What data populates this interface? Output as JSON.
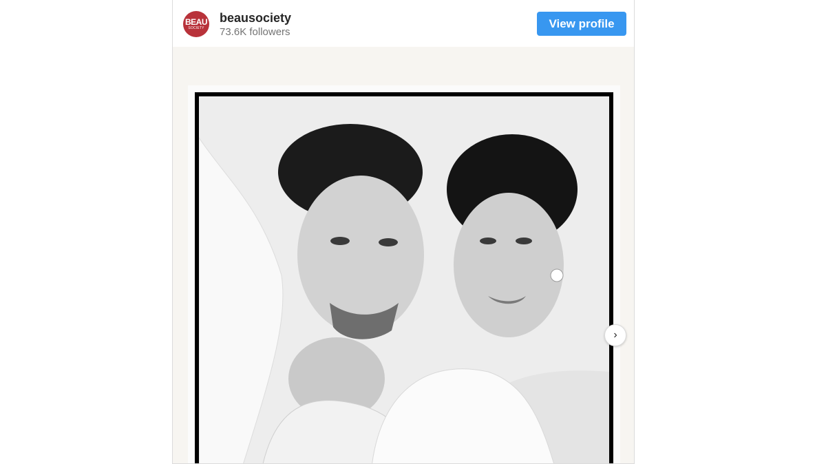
{
  "profile": {
    "avatar_line1": "BEAU",
    "avatar_line2": "SOCIETY",
    "username": "beausociety",
    "followers": "73.6K followers",
    "view_profile_label": "View profile"
  },
  "carousel": {
    "next_icon": "chevron-right-icon",
    "next_glyph": "›"
  },
  "colors": {
    "accent": "#3897f0",
    "avatar_bg": "#b8323a",
    "media_bg": "#f7f5f1"
  }
}
